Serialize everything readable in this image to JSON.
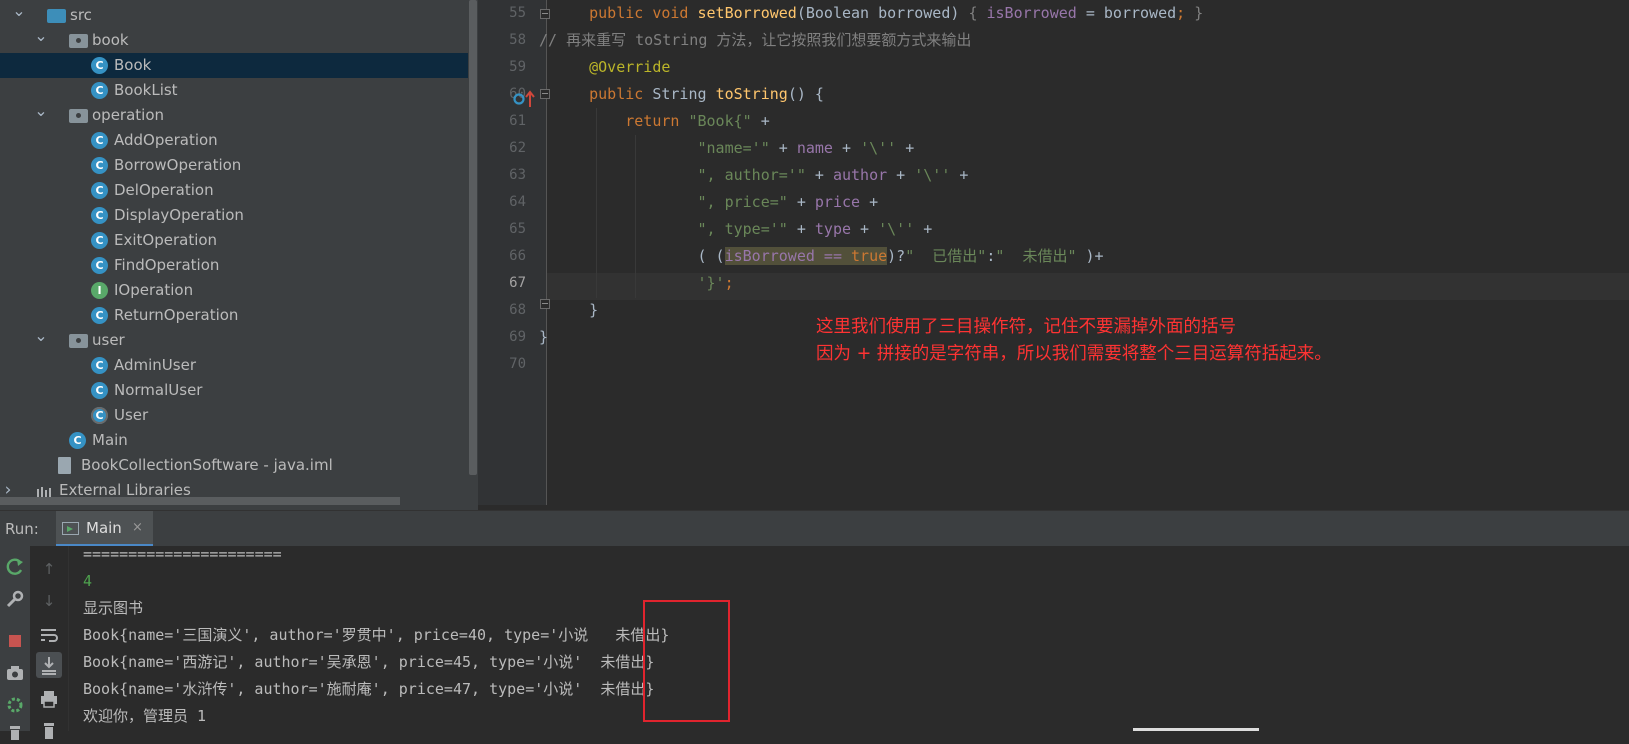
{
  "project_tree": {
    "items": [
      {
        "label": "src",
        "type": "src-folder",
        "expanded": true,
        "indent": 0
      },
      {
        "label": "book",
        "type": "package",
        "expanded": true,
        "indent": 1
      },
      {
        "label": "Book",
        "type": "class",
        "indent": 2,
        "selected": true
      },
      {
        "label": "BookList",
        "type": "class",
        "indent": 2
      },
      {
        "label": "operation",
        "type": "package",
        "expanded": true,
        "indent": 1
      },
      {
        "label": "AddOperation",
        "type": "class",
        "indent": 2
      },
      {
        "label": "BorrowOperation",
        "type": "class",
        "indent": 2
      },
      {
        "label": "DelOperation",
        "type": "class",
        "indent": 2
      },
      {
        "label": "DisplayOperation",
        "type": "class",
        "indent": 2
      },
      {
        "label": "ExitOperation",
        "type": "class",
        "indent": 2
      },
      {
        "label": "FindOperation",
        "type": "class",
        "indent": 2
      },
      {
        "label": "IOperation",
        "type": "interface",
        "indent": 2
      },
      {
        "label": "ReturnOperation",
        "type": "class",
        "indent": 2
      },
      {
        "label": "user",
        "type": "package",
        "expanded": true,
        "indent": 1
      },
      {
        "label": "AdminUser",
        "type": "class",
        "indent": 2
      },
      {
        "label": "NormalUser",
        "type": "class",
        "indent": 2
      },
      {
        "label": "User",
        "type": "abstract-class",
        "indent": 2
      },
      {
        "label": "Main",
        "type": "class",
        "indent": 1
      },
      {
        "label": "BookCollectionSoftware - java.iml",
        "type": "iml",
        "indent": 0.5
      },
      {
        "label": "External Libraries",
        "type": "libraries",
        "expanded": false,
        "indent": -0.5
      }
    ],
    "icon_letters": {
      "class": "C",
      "interface": "I"
    }
  },
  "editor": {
    "line_numbers": [
      "55",
      "58",
      "59",
      "60",
      "61",
      "62",
      "63",
      "64",
      "65",
      "66",
      "67",
      "68",
      "69",
      "70"
    ],
    "current_line": "67",
    "annotation": {
      "line1": "这里我们使用了三目操作符，记住不要漏掉外面的括号",
      "line2": "因为 + 拼接的是字符串，所以我们需要将整个三目运算符括起来。",
      "color": "#ff3333"
    }
  },
  "run_panel": {
    "label": "Run:",
    "tab": "Main",
    "close": "×",
    "console_lines": [
      {
        "text": "======================",
        "kind": "output"
      },
      {
        "text": "4",
        "kind": "input"
      },
      {
        "text": "显示图书",
        "kind": "output"
      },
      {
        "text": "Book{name='三国演义', author='罗贯中', price=40, type='小说   未借出}",
        "kind": "output"
      },
      {
        "text": "Book{name='西游记', author='吴承恩', price=45, type='小说'  未借出}",
        "kind": "output"
      },
      {
        "text": "Book{name='水浒传', author='施耐庵', price=47, type='小说'  未借出}",
        "kind": "output"
      },
      {
        "text": "欢迎你，管理员 1",
        "kind": "output"
      }
    ]
  },
  "colors": {
    "accent": "#4a88c7",
    "highlight_box": "#e0242e"
  }
}
